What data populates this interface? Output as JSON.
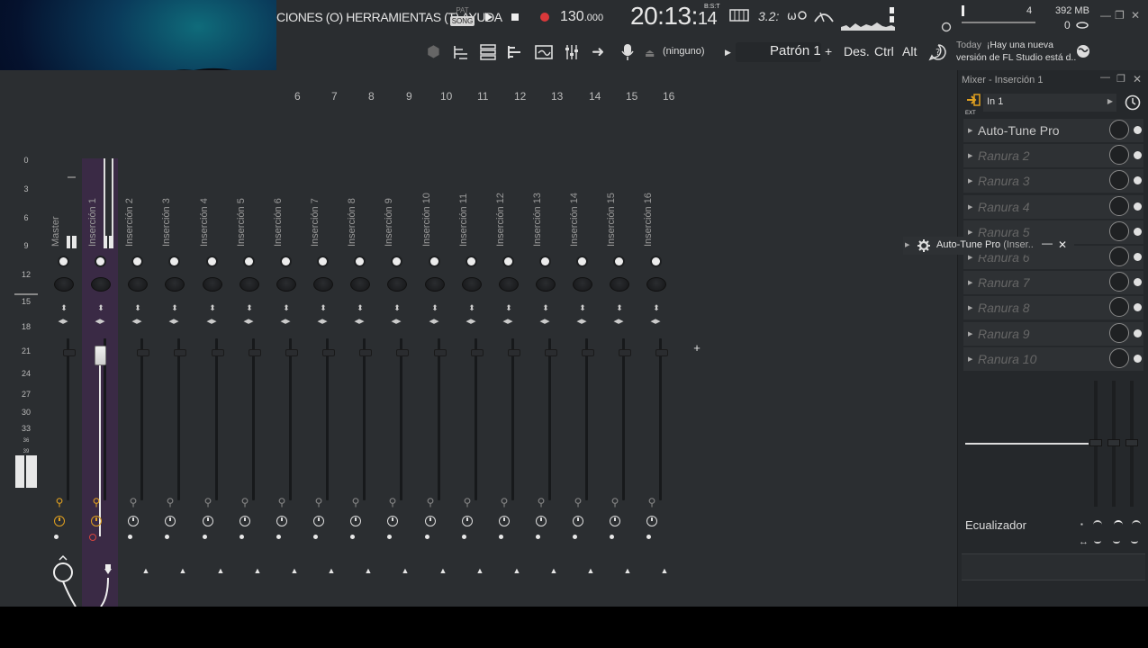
{
  "menu": {
    "text": "CIONES (O) HERRAMIENTAS (T) AYUDA"
  },
  "transport": {
    "pat_label": "PAT",
    "song_label": "SONG",
    "tempo": "130",
    "tempo_decimals": ".000",
    "time_main": "20:13",
    "time_sub": "14",
    "time_format": "B:S:T",
    "snap_label": "3.2:"
  },
  "memory": {
    "ram": "392 MB",
    "polyphony": "0",
    "cpu_count": "4"
  },
  "toolbar2": {
    "midi_input": "(ninguno)",
    "pattern": "Patrón 1",
    "pattern_add": "+",
    "des": "Des.",
    "ctrl": "Ctrl",
    "alt": "Alt"
  },
  "news": {
    "today": "Today",
    "line1": "¡Hay una nueva",
    "line2": "versión de FL Studio está d.."
  },
  "mixer": {
    "column_numbers": [
      "6",
      "7",
      "8",
      "9",
      "10",
      "11",
      "12",
      "13",
      "14",
      "15",
      "16"
    ],
    "db_labels": [
      "0",
      "3",
      "6",
      "9",
      "12",
      "15",
      "18",
      "21",
      "24",
      "27",
      "30",
      "33",
      "36",
      "39"
    ],
    "strips": [
      "Master",
      "Inserción 1",
      "Inserción 2",
      "Inserción 3",
      "Inserción 4",
      "Inserción 5",
      "Inserción 6",
      "Inserción 7",
      "Inserción 8",
      "Inserción 9",
      "Inserción 10",
      "Inserción 11",
      "Inserción 12",
      "Inserción 13",
      "Inserción 14",
      "Inserción 15",
      "Inserción 16"
    ],
    "selected_strip": "Inserción 1"
  },
  "panel": {
    "title": "Mixer - Inserción 1",
    "input": "In 1",
    "input_sub": "EXT",
    "slots": [
      "Auto-Tune Pro",
      "Ranura 2",
      "Ranura 3",
      "Ranura 4",
      "Ranura 5",
      "Ranura 6",
      "Ranura 7",
      "Ranura 8",
      "Ranura 9",
      "Ranura 10"
    ],
    "eq_label": "Ecualizador"
  },
  "popup": {
    "title": "Auto-Tune Pro",
    "suffix": "(Inser.."
  },
  "colors": {
    "accent_selected": "#3a2a45",
    "record": "#d9383a",
    "bulb_on": "#e0a020"
  }
}
